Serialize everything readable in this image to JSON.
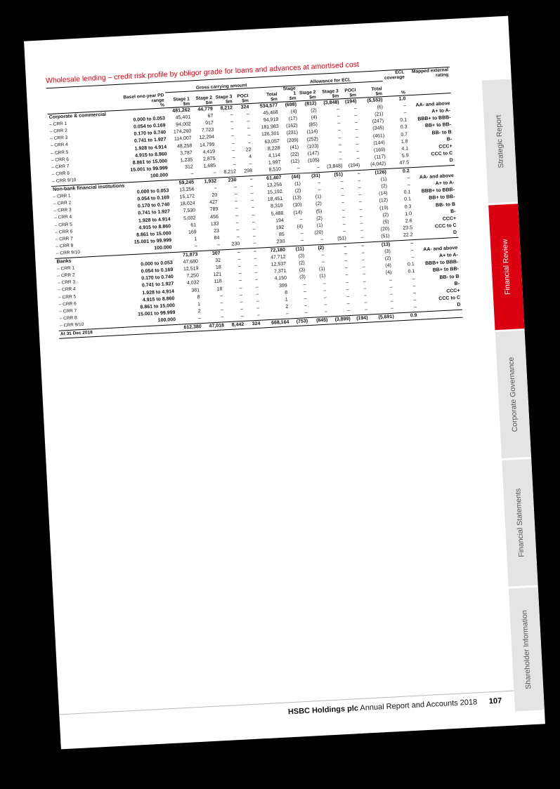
{
  "title": "Wholesale lending – credit risk profile by obligor grade for loans and advances at amortised cost",
  "headers": {
    "group_gross": "Gross carrying amount",
    "group_allowance": "Allowance for ECL",
    "pd": "Basel one-year PD range",
    "stage1": "Stage 1",
    "stage2": "Stage 2",
    "stage3": "Stage 3",
    "poci": "POCI",
    "total": "Total",
    "a_stage1": "Stage 1",
    "a_stage2": "Stage 2",
    "a_stage3": "Stage 3",
    "a_poci": "POCI",
    "a_total": "Total",
    "ecl": "ECL coverage",
    "mapped": "Mapped external rating",
    "unit_pct": "%",
    "unit_sm": "$m"
  },
  "sections": [
    {
      "name": "Corporate & commercial",
      "summary": [
        "",
        "481,262",
        "44,779",
        "8,212",
        "324",
        "534,577",
        "(698)",
        "(812)",
        "(3,848)",
        "(194)",
        "(5,552)",
        "1.0",
        ""
      ],
      "rows": [
        [
          "– CRR 1",
          "0.000 to 0.053",
          "45,401",
          "67",
          "–",
          "–",
          "45,468",
          "(4)",
          "(2)",
          "–",
          "–",
          "(6)",
          "–",
          "AA- and above"
        ],
        [
          "– CRR 2",
          "0.054 to 0.169",
          "94,002",
          "917",
          "–",
          "–",
          "94,919",
          "(17)",
          "(4)",
          "–",
          "–",
          "(21)",
          "–",
          "A+ to A-"
        ],
        [
          "– CRR 3",
          "0.170 to 0.740",
          "174,260",
          "7,723",
          "–",
          "–",
          "181,983",
          "(162)",
          "(85)",
          "–",
          "–",
          "(247)",
          "0.1",
          "BBB+ to BBB-"
        ],
        [
          "– CRR 4",
          "0.741 to 1.927",
          "114,007",
          "12,294",
          "–",
          "–",
          "126,301",
          "(231)",
          "(114)",
          "–",
          "–",
          "(345)",
          "0.3",
          "BB+ to BB-"
        ],
        [
          "– CRR 5",
          "1.928 to 4.914",
          "48,258",
          "14,799",
          "–",
          "–",
          "63,057",
          "(209)",
          "(252)",
          "–",
          "–",
          "(461)",
          "0.7",
          "BB- to B"
        ],
        [
          "– CRR 6",
          "4.915 to 8.860",
          "3,787",
          "4,419",
          "–",
          "22",
          "8,228",
          "(41)",
          "(103)",
          "–",
          "–",
          "(144)",
          "1.8",
          "B-"
        ],
        [
          "– CRR 7",
          "8.861 to 15.000",
          "1,235",
          "2,875",
          "–",
          "4",
          "4,114",
          "(22)",
          "(147)",
          "–",
          "–",
          "(169)",
          "4.1",
          "CCC+"
        ],
        [
          "– CRR 8",
          "15.001 to 99.999",
          "312",
          "1,685",
          "–",
          "–",
          "1,997",
          "(12)",
          "(105)",
          "–",
          "–",
          "(117)",
          "5.9",
          "CCC to C"
        ],
        [
          "– CRR 9/10",
          "100.000",
          "–",
          "–",
          "8,212",
          "298",
          "8,510",
          "–",
          "–",
          "(3,848)",
          "(194)",
          "(4,042)",
          "47.5",
          "D"
        ]
      ]
    },
    {
      "name": "Non-bank financial institutions",
      "summary": [
        "",
        "59,245",
        "1,932",
        "230",
        "–",
        "61,407",
        "(44)",
        "(31)",
        "(51)",
        "–",
        "(126)",
        "0.2",
        ""
      ],
      "rows": [
        [
          "– CRR 1",
          "0.000 to 0.053",
          "13,256",
          "–",
          "–",
          "–",
          "13,256",
          "(1)",
          "–",
          "–",
          "–",
          "(1)",
          "–",
          "AA- and above"
        ],
        [
          "– CRR 2",
          "0.054 to 0.169",
          "15,172",
          "20",
          "–",
          "–",
          "15,192",
          "(2)",
          "–",
          "–",
          "–",
          "(2)",
          "–",
          "A+ to A-"
        ],
        [
          "– CRR 3",
          "0.170 to 0.740",
          "18,024",
          "427",
          "–",
          "–",
          "18,451",
          "(13)",
          "(1)",
          "–",
          "–",
          "(14)",
          "0.1",
          "BBB+ to BBB-"
        ],
        [
          "– CRR 4",
          "0.741 to 1.927",
          "7,530",
          "789",
          "–",
          "–",
          "8,319",
          "(10)",
          "(2)",
          "–",
          "–",
          "(12)",
          "0.1",
          "BB+ to BB-"
        ],
        [
          "– CRR 5",
          "1.928 to 4.914",
          "5,032",
          "456",
          "–",
          "–",
          "5,488",
          "(14)",
          "(5)",
          "–",
          "–",
          "(19)",
          "0.3",
          "BB- to B"
        ],
        [
          "– CRR 6",
          "4.915 to 8.860",
          "61",
          "133",
          "–",
          "–",
          "194",
          "–",
          "(2)",
          "–",
          "–",
          "(2)",
          "1.0",
          "B-"
        ],
        [
          "– CRR 7",
          "8.861 to 15.000",
          "169",
          "23",
          "–",
          "–",
          "192",
          "(4)",
          "(1)",
          "–",
          "–",
          "(5)",
          "2.6",
          "CCC+"
        ],
        [
          "– CRR 8",
          "15.001 to 99.999",
          "1",
          "84",
          "–",
          "–",
          "85",
          "–",
          "(20)",
          "–",
          "–",
          "(20)",
          "23.5",
          "CCC to C"
        ],
        [
          "– CRR 9/10",
          "100.000",
          "–",
          "–",
          "230",
          "–",
          "230",
          "–",
          "–",
          "(51)",
          "–",
          "(51)",
          "22.2",
          "D"
        ]
      ]
    },
    {
      "name": "Banks",
      "summary": [
        "",
        "71,873",
        "307",
        "–",
        "–",
        "72,180",
        "(11)",
        "(2)",
        "–",
        "–",
        "(13)",
        "–",
        ""
      ],
      "rows": [
        [
          "– CRR 1",
          "0.000 to 0.053",
          "47,680",
          "32",
          "–",
          "–",
          "47,712",
          "(3)",
          "–",
          "–",
          "–",
          "(3)",
          "–",
          "AA- and above"
        ],
        [
          "– CRR 2",
          "0.054 to 0.169",
          "12,519",
          "18",
          "–",
          "–",
          "12,537",
          "(2)",
          "–",
          "–",
          "–",
          "(2)",
          "–",
          "A+ to A-"
        ],
        [
          "– CRR 3",
          "0.170 to 0.740",
          "7,250",
          "121",
          "–",
          "–",
          "7,371",
          "(3)",
          "(1)",
          "–",
          "–",
          "(4)",
          "0.1",
          "BBB+ to BBB-"
        ],
        [
          "– CRR 4",
          "0.741 to 1.927",
          "4,032",
          "118",
          "–",
          "–",
          "4,150",
          "(3)",
          "(1)",
          "–",
          "–",
          "(4)",
          "0.1",
          "BB+ to BB-"
        ],
        [
          "– CRR 5",
          "1.928 to 4.914",
          "381",
          "18",
          "–",
          "–",
          "399",
          "–",
          "–",
          "–",
          "–",
          "–",
          "–",
          "BB- to B"
        ],
        [
          "– CRR 6",
          "4.915 to 8.860",
          "8",
          "–",
          "–",
          "–",
          "8",
          "–",
          "–",
          "–",
          "–",
          "–",
          "–",
          "B-"
        ],
        [
          "– CRR 7",
          "8.861 to 15.000",
          "1",
          "–",
          "–",
          "–",
          "1",
          "–",
          "–",
          "–",
          "–",
          "–",
          "–",
          "CCC+"
        ],
        [
          "– CRR 8",
          "15.001 to 99.999",
          "2",
          "–",
          "–",
          "–",
          "2",
          "–",
          "–",
          "–",
          "–",
          "–",
          "–",
          "CCC to C"
        ],
        [
          "– CRR 9/10",
          "100.000",
          "–",
          "–",
          "–",
          "–",
          "–",
          "–",
          "–",
          "–",
          "–",
          "–",
          "–",
          "D"
        ]
      ]
    }
  ],
  "total": {
    "label": "At 31 Dec 2018",
    "values": [
      "",
      "612,380",
      "47,018",
      "8,442",
      "324",
      "668,164",
      "(753)",
      "(845)",
      "(3,899)",
      "(194)",
      "(5,691)",
      "0.9",
      ""
    ]
  },
  "footer": {
    "company": "HSBC Holdings plc",
    "doc": "Annual Report and Accounts 2018",
    "page": "107"
  },
  "tabs": [
    "Strategic Report",
    "Financial Review",
    "Corporate Governance",
    "Financial Statements",
    "Shareholder Information"
  ],
  "active_tab": "Financial Review",
  "colors": {
    "brand_red": "#db0011",
    "tab_grey": "#e4e4e4"
  }
}
